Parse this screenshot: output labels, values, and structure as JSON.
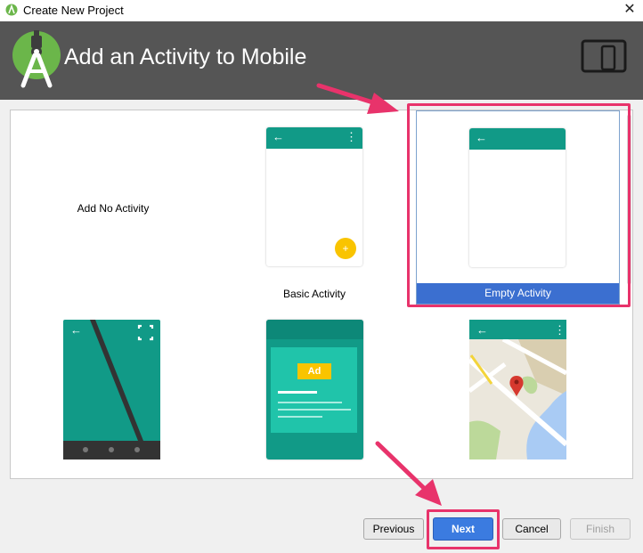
{
  "window": {
    "title": "Create New Project",
    "close_glyph": "✕"
  },
  "header": {
    "heading": "Add an Activity to Mobile"
  },
  "gallery": {
    "tiles": [
      {
        "label": "Add No Activity"
      },
      {
        "label": "Basic Activity",
        "fab": "+"
      },
      {
        "label": "Empty Activity",
        "selected": true
      },
      {
        "label": ""
      },
      {
        "label": "",
        "ad_text": "Ad"
      },
      {
        "label": ""
      }
    ],
    "back_glyph": "←",
    "menu_glyph": "⋮"
  },
  "buttons": {
    "previous": "Previous",
    "next": "Next",
    "cancel": "Cancel",
    "finish": "Finish"
  },
  "colors": {
    "header_bg": "#555555",
    "teal": "#119a87",
    "selection_blue": "#3b6fd0",
    "highlight_pink": "#e8336b",
    "fab_yellow": "#f9c400"
  }
}
